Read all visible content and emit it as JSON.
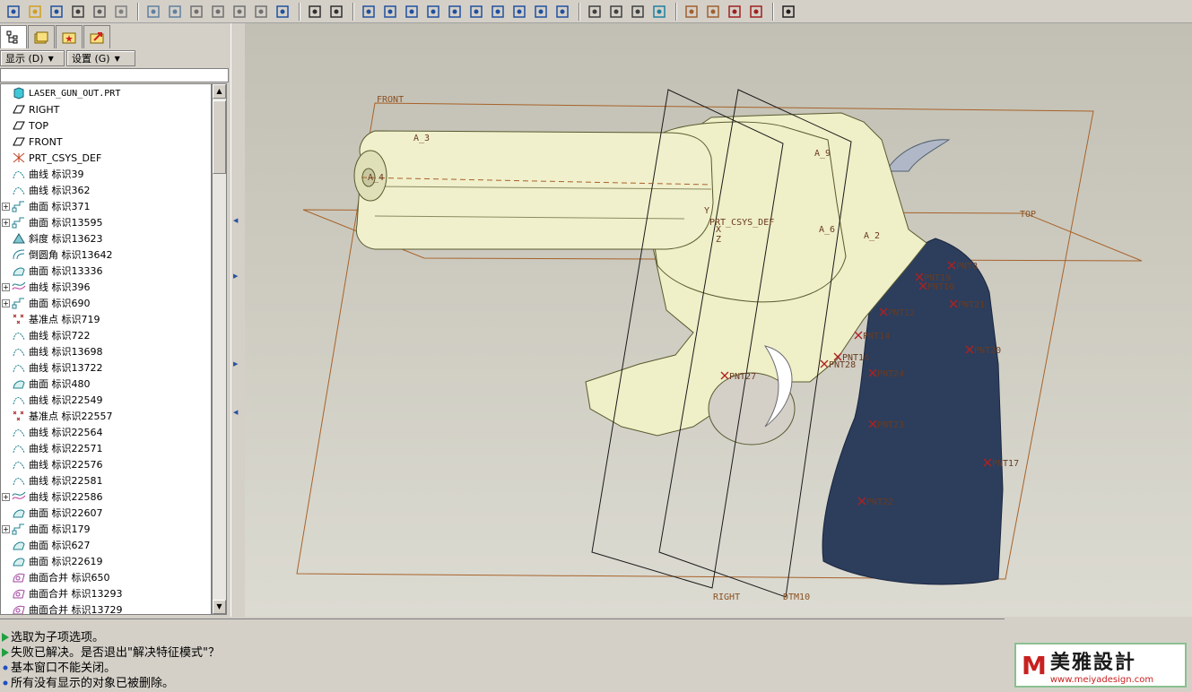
{
  "toolbar": {
    "icons": [
      "new-icon",
      "open-icon",
      "save-icon",
      "print-icon",
      "send-icon",
      "mail-icon",
      "undo-icon",
      "redo-icon",
      "cut-icon",
      "copy-icon",
      "paste-icon",
      "paste-special-icon",
      "regenerate-icon",
      "find-icon",
      "select-box-icon",
      "repaint-icon",
      "spin-center-icon",
      "orient-icon",
      "zoom-in-icon",
      "zoom-out-icon",
      "refit-icon",
      "reorient-icon",
      "saved-views-icon",
      "layers-icon",
      "view-manager-icon",
      "wireframe-icon",
      "hidden-line-icon",
      "no-hidden-icon",
      "shading-icon",
      "datum-planes-icon",
      "datum-axes-icon",
      "datum-points-icon",
      "csys-icon",
      "whats-this-icon"
    ]
  },
  "left_panel": {
    "tabs": [
      "model-tree-tab",
      "layer-tree-tab",
      "favorites-tab",
      "history-tab"
    ],
    "show_dropdown": "显示 (D)",
    "settings_dropdown": "设置 (G)",
    "tree": {
      "root": "LASER_GUN_OUT.PRT",
      "items": [
        {
          "label": "RIGHT",
          "icon": "datum-plane-icon",
          "expandable": false
        },
        {
          "label": "TOP",
          "icon": "datum-plane-icon",
          "expandable": false
        },
        {
          "label": "FRONT",
          "icon": "datum-plane-icon",
          "expandable": false
        },
        {
          "label": "PRT_CSYS_DEF",
          "icon": "csys-icon",
          "expandable": false
        },
        {
          "label": "曲线 标识39",
          "icon": "curve-icon",
          "expandable": false
        },
        {
          "label": "曲线 标识362",
          "icon": "curve-icon",
          "expandable": false
        },
        {
          "label": "曲面 标识371",
          "icon": "surface-icon",
          "expandable": true
        },
        {
          "label": "曲面 标识13595",
          "icon": "surface-icon",
          "expandable": true
        },
        {
          "label": "斜度 标识13623",
          "icon": "draft-icon",
          "expandable": false
        },
        {
          "label": "倒圆角 标识13642",
          "icon": "round-icon",
          "expandable": false
        },
        {
          "label": "曲面 标识13336",
          "icon": "surface-blend-icon",
          "expandable": false
        },
        {
          "label": "曲线 标识396",
          "icon": "curve-group-icon",
          "expandable": true
        },
        {
          "label": "曲面 标识690",
          "icon": "surface-icon",
          "expandable": true
        },
        {
          "label": "基准点 标识719",
          "icon": "datum-point-icon",
          "expandable": false
        },
        {
          "label": "曲线 标识722",
          "icon": "curve-icon",
          "expandable": false
        },
        {
          "label": "曲线 标识13698",
          "icon": "curve-icon",
          "expandable": false
        },
        {
          "label": "曲线 标识13722",
          "icon": "curve-icon",
          "expandable": false
        },
        {
          "label": "曲面 标识480",
          "icon": "surface-blend-icon",
          "expandable": false
        },
        {
          "label": "曲线 标识22549",
          "icon": "curve-icon",
          "expandable": false
        },
        {
          "label": "基准点 标识22557",
          "icon": "datum-point-icon",
          "expandable": false
        },
        {
          "label": "曲线 标识22564",
          "icon": "curve-icon",
          "expandable": false
        },
        {
          "label": "曲线 标识22571",
          "icon": "curve-icon",
          "expandable": false
        },
        {
          "label": "曲线 标识22576",
          "icon": "curve-icon",
          "expandable": false
        },
        {
          "label": "曲线 标识22581",
          "icon": "curve-icon",
          "expandable": false
        },
        {
          "label": "曲线 标识22586",
          "icon": "curve-group-icon",
          "expandable": true
        },
        {
          "label": "曲面 标识22607",
          "icon": "surface-blend-icon",
          "expandable": false
        },
        {
          "label": "曲面 标识179",
          "icon": "surface-icon",
          "expandable": true
        },
        {
          "label": "曲面 标识627",
          "icon": "surface-blend-icon",
          "expandable": false
        },
        {
          "label": "曲面 标识22619",
          "icon": "surface-blend-icon",
          "expandable": false
        },
        {
          "label": "曲面合并 标识650",
          "icon": "merge-icon",
          "expandable": false
        },
        {
          "label": "曲面合并 标识13293",
          "icon": "merge-icon",
          "expandable": false
        },
        {
          "label": "曲面合并 标识13729",
          "icon": "merge-icon",
          "expandable": false
        }
      ]
    }
  },
  "viewport": {
    "planes": {
      "front": "FRONT",
      "top": "TOP",
      "right": "RIGHT",
      "dtm": "DTM10"
    },
    "csys": "PRT_CSYS_DEF",
    "axes": {
      "a3": "A_3",
      "a4": "A_4",
      "a9": "A_9",
      "a6": "A_6",
      "a2": "A_2",
      "x": "X",
      "y": "Y",
      "z": "Z"
    },
    "points": [
      "PNT8",
      "PNT19",
      "PNT10",
      "PNT21",
      "PNT12",
      "PNT14",
      "PNT16",
      "PNT28",
      "PNT24",
      "PNT20",
      "PNT27",
      "PNT23",
      "PNT17",
      "PNT22"
    ],
    "colors": {
      "body": "#efefc8",
      "grip": "#2c3e5c",
      "datum": "#a8622a",
      "frame": "#1a1a1a"
    }
  },
  "messages": [
    {
      "text": "选取为子项选项。",
      "type": "prompt"
    },
    {
      "text": "失败已解决。是否退出\"解决特征模式\"？",
      "type": "prompt"
    },
    {
      "text": "基本窗口不能关闭。",
      "type": "info"
    },
    {
      "text": "所有没有显示的对象已被删除。",
      "type": "info"
    }
  ],
  "logo": {
    "mark": "M",
    "name": "美雅設計",
    "url": "www.meiyadesign.com"
  }
}
